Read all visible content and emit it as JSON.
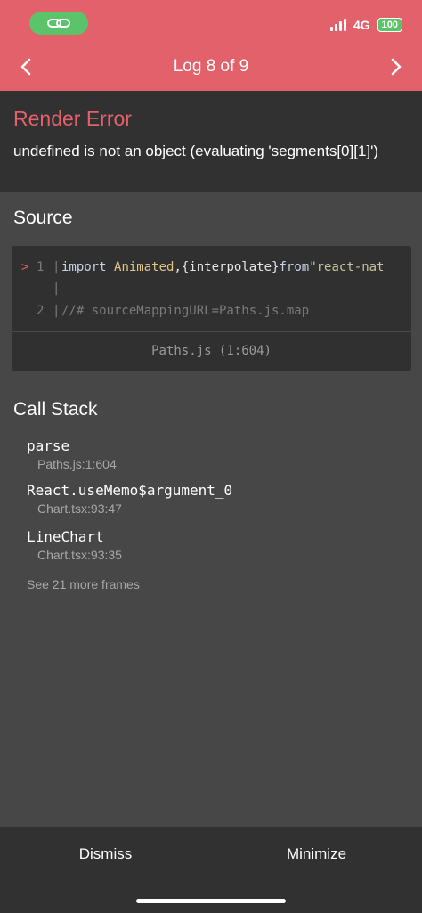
{
  "status_bar": {
    "network": "4G",
    "battery": "100"
  },
  "nav": {
    "title": "Log 8 of 9"
  },
  "error": {
    "title": "Render Error",
    "message": "undefined is not an object (evaluating 'segments[0][1]')"
  },
  "source": {
    "heading": "Source",
    "lines": [
      {
        "marker": ">",
        "number": "1",
        "keyword": "import",
        "identifier": "Animated",
        "punct": ",{interpolate}",
        "keyword2": "from",
        "string": "\"react-nat"
      },
      {
        "number": "",
        "text": ""
      },
      {
        "number": "2",
        "comment": "//# sourceMappingURL=Paths.js.map"
      }
    ],
    "file_location": "Paths.js (1:604)"
  },
  "call_stack": {
    "heading": "Call Stack",
    "frames": [
      {
        "function": "parse",
        "location": "Paths.js:1:604"
      },
      {
        "function": "React.useMemo$argument_0",
        "location": "Chart.tsx:93:47"
      },
      {
        "function": "LineChart",
        "location": "Chart.tsx:93:35"
      }
    ],
    "more_frames": "See 21 more frames"
  },
  "actions": {
    "dismiss": "Dismiss",
    "minimize": "Minimize"
  },
  "colors": {
    "header": "#e2616b",
    "error_title": "#e2616b",
    "panel": "#313131",
    "background": "#474747",
    "status_pill": "#5bc46a"
  },
  "icons": {
    "status_pill": "link-icon",
    "prev": "chevron-left-icon",
    "next": "chevron-right-icon"
  }
}
